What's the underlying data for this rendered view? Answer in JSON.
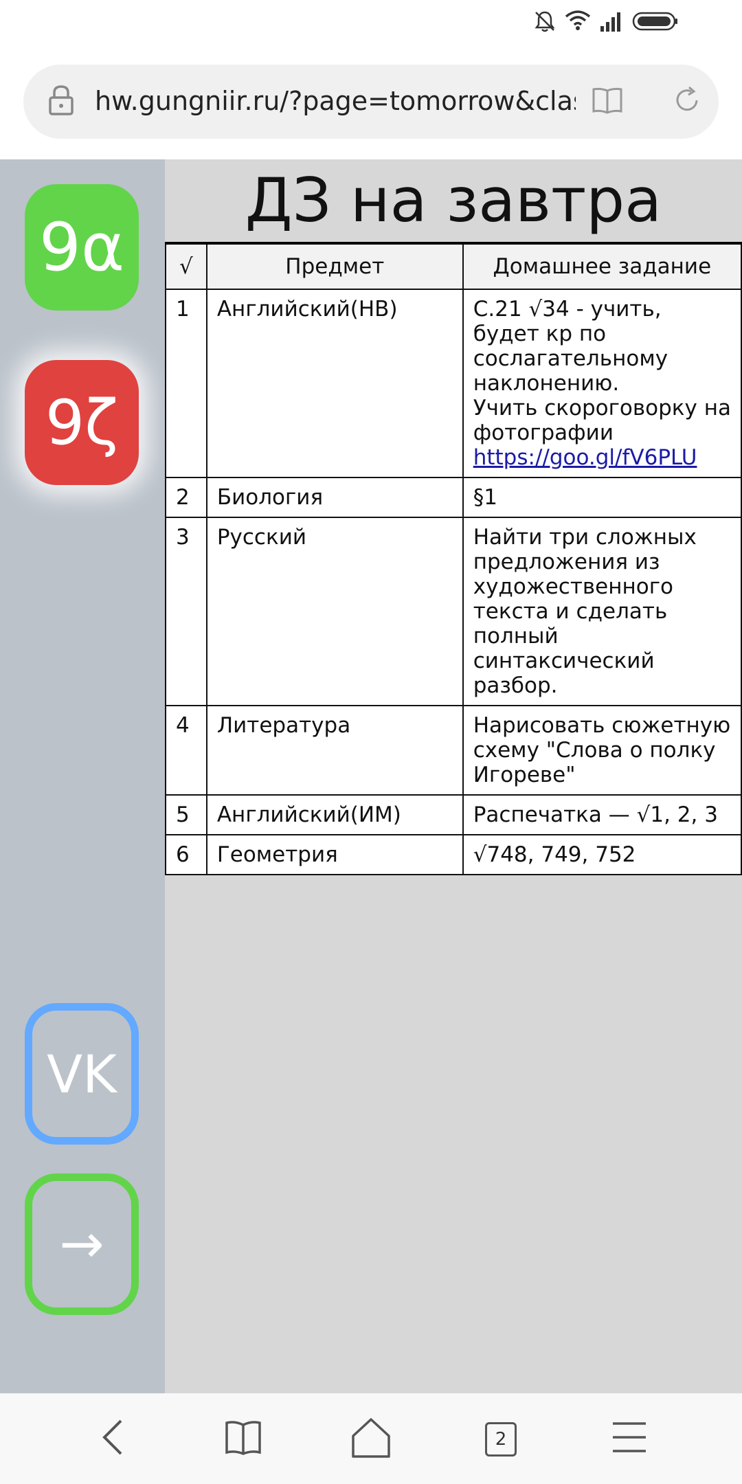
{
  "browser": {
    "url": "hw.gungniir.ru/?page=tomorrow&class",
    "tab_count": "2"
  },
  "sidebar": {
    "class_9a": "9α",
    "class_9b": "9ζ",
    "vk_label": "VK",
    "next_label": "→"
  },
  "page": {
    "title": "ДЗ на завтра"
  },
  "table": {
    "headers": [
      "√",
      "Предмет",
      "Домашнее задание"
    ],
    "rows": [
      {
        "num": "1",
        "subject": "Английский(НВ)",
        "task_lines": [
          "С.21 √34 - учить, будет кр по сослагательному наклонению.",
          "Учить скороговорку на фотографии"
        ],
        "link": "https://goo.gl/fV6PLU"
      },
      {
        "num": "2",
        "subject": "Биология",
        "task_lines": [
          "§1"
        ]
      },
      {
        "num": "3",
        "subject": "Русский",
        "task_lines": [
          "Найти три сложных предложения из художественного текста и сделать полный синтаксический разбор."
        ]
      },
      {
        "num": "4",
        "subject": "Литература",
        "task_lines": [
          "Нарисовать сюжетную схему \"Слова о полку Игореве\""
        ]
      },
      {
        "num": "5",
        "subject": "Английский(ИМ)",
        "task_lines": [
          "Распечатка — √1, 2, 3"
        ]
      },
      {
        "num": "6",
        "subject": "Геометрия",
        "task_lines": [
          "√748, 749, 752"
        ]
      }
    ]
  },
  "colors": {
    "btn_9a": "#62d44a",
    "btn_9b": "#e0423f",
    "vk_border": "#62a9ff",
    "next_border": "#62d44a",
    "sidebar_bg": "#bbc2ca",
    "page_bg": "#d7d7d7"
  },
  "icons": {
    "status": [
      "bell-muted-icon",
      "wifi-icon",
      "signal-icon",
      "battery-icon"
    ],
    "address": [
      "lock-icon",
      "reader-mode-icon",
      "reload-icon"
    ],
    "nav": [
      "back-icon",
      "bookmarks-icon",
      "home-icon",
      "tabs-icon",
      "menu-icon"
    ]
  }
}
